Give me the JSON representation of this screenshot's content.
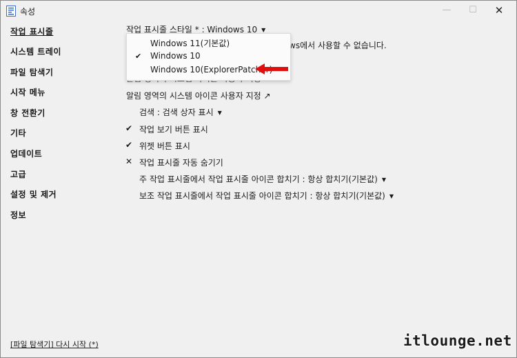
{
  "window": {
    "title": "속성",
    "minimize": "—",
    "maximize": "☐",
    "close": "✕"
  },
  "sidebar": {
    "items": [
      {
        "label": "작업 표시줄"
      },
      {
        "label": "시스템 트레이"
      },
      {
        "label": "파일 탐색기"
      },
      {
        "label": "시작 메뉴"
      },
      {
        "label": "창 전환기"
      },
      {
        "label": "기타"
      },
      {
        "label": "업데이트"
      },
      {
        "label": "고급"
      },
      {
        "label": "설정 및 제거"
      },
      {
        "label": "정보"
      }
    ],
    "restart_link": "[파일 탐색기] 다시 시작 (*)"
  },
  "main": {
    "taskbar_style": "작업 표시줄 스타일 * : Windows 10",
    "partial_message": "ws에서 사용할 수 없습니다.",
    "hidden_row": "알림 영역의 시스템 아이콘 사용자 지정",
    "notification_row": "알림 영역의 시스템 아이콘 사용자 지정 ↗",
    "search": "검색 : 검색 상자 표시",
    "taskview": "작업 보기 버튼 표시",
    "widgets": "위젯 버튼 표시",
    "autohide": "작업 표시줄 자동 숨기기",
    "combine_main": "주 작업 표시줄에서 작업 표시줄 아이콘 합치기 : 항상 합치기(기본값)",
    "combine_secondary": "보조 작업 표시줄에서 작업 표시줄 아이콘 합치기 : 항상 합치기(기본값)",
    "check_mark": "✔",
    "x_mark": "✕",
    "dropdown_arrow": "▼"
  },
  "dropdown": {
    "options": [
      {
        "label": "Windows 11(기본값)",
        "selected": false
      },
      {
        "label": "Windows 10",
        "selected": true
      },
      {
        "label": "Windows 10(ExplorerPatcher)",
        "selected": false
      }
    ],
    "check": "✔"
  },
  "annotation": {
    "arrow_color": "#e01010"
  },
  "watermark": "itlounge.net"
}
